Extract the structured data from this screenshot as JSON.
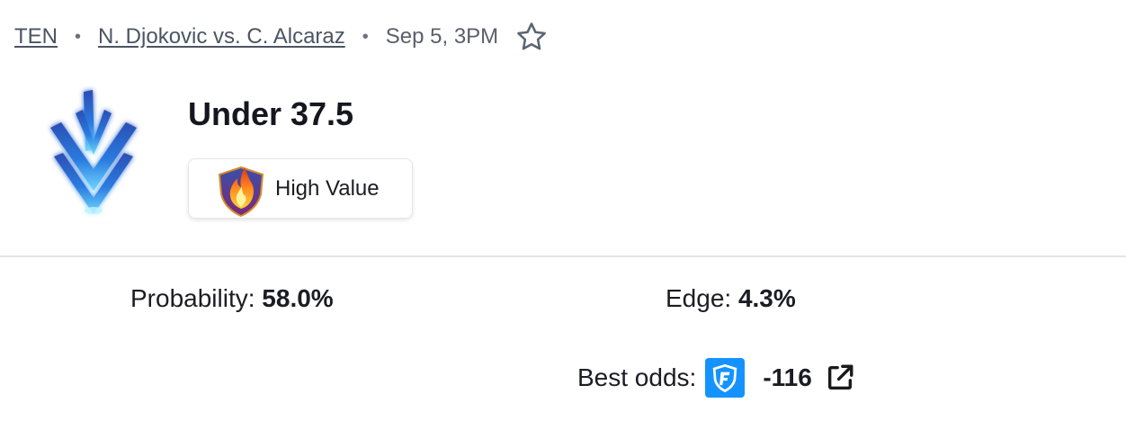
{
  "breadcrumb": {
    "sport": "TEN",
    "separator": "•",
    "matchup": "N. Djokovic vs. C. Alcaraz",
    "datetime": "Sep 5, 3PM",
    "favorite_icon": "star-outline-icon"
  },
  "pick": {
    "icon": "chevron-down-arrow-icon",
    "title": "Under 37.5",
    "badge": {
      "icon": "fire-shield-icon",
      "label": "High Value"
    }
  },
  "stats": {
    "probability_label": "Probability:",
    "probability_value": "58.0%",
    "edge_label": "Edge:",
    "edge_value": "4.3%",
    "best_odds_label": "Best odds:",
    "best_odds_value": "-116",
    "sportsbook_icon": "fanduel-logo-icon",
    "external_link_icon": "external-link-icon"
  },
  "colors": {
    "accent_blue": "#1493ff",
    "pick_icon_blue": "#1e6fd9",
    "text_muted": "#5a5f6b"
  }
}
